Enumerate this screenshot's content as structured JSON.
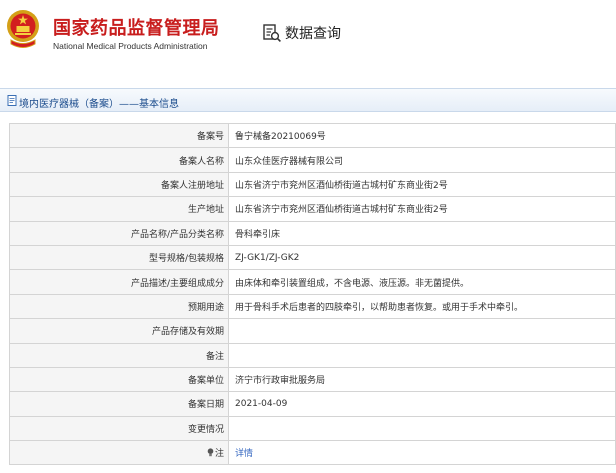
{
  "header": {
    "org_cn": "国家药品监督管理局",
    "org_en": "National Medical Products Administration",
    "query_title": "数据查询"
  },
  "breadcrumb": {
    "text": "境内医疗器械（备案）——基本信息"
  },
  "colors": {
    "brand_red": "#c81d1d",
    "link_blue": "#3467c0",
    "crumb_blue": "#1a4b8c"
  },
  "rows": [
    {
      "label": "备案号",
      "value": "鲁宁械备20210069号"
    },
    {
      "label": "备案人名称",
      "value": "山东众佳医疗器械有限公司"
    },
    {
      "label": "备案人注册地址",
      "value": "山东省济宁市兖州区酒仙桥街道古城村矿东商业街2号"
    },
    {
      "label": "生产地址",
      "value": "山东省济宁市兖州区酒仙桥街道古城村矿东商业街2号"
    },
    {
      "label": "产品名称/产品分类名称",
      "value": "骨科牵引床"
    },
    {
      "label": "型号规格/包装规格",
      "value": "ZJ-GK1/ZJ-GK2"
    },
    {
      "label": "产品描述/主要组成成分",
      "value": "由床体和牵引装置组成，不含电源、液压源。非无菌提供。"
    },
    {
      "label": "预期用途",
      "value": "用于骨科手术后患者的四肢牵引，以帮助患者恢复。或用于手术中牵引。"
    },
    {
      "label": "产品存储及有效期",
      "value": ""
    },
    {
      "label": "备注",
      "value": ""
    },
    {
      "label": "备案单位",
      "value": "济宁市行政审批服务局"
    },
    {
      "label": "备案日期",
      "value": "2021-04-09"
    },
    {
      "label": "变更情况",
      "value": ""
    },
    {
      "label": "注",
      "value": "详情"
    }
  ]
}
